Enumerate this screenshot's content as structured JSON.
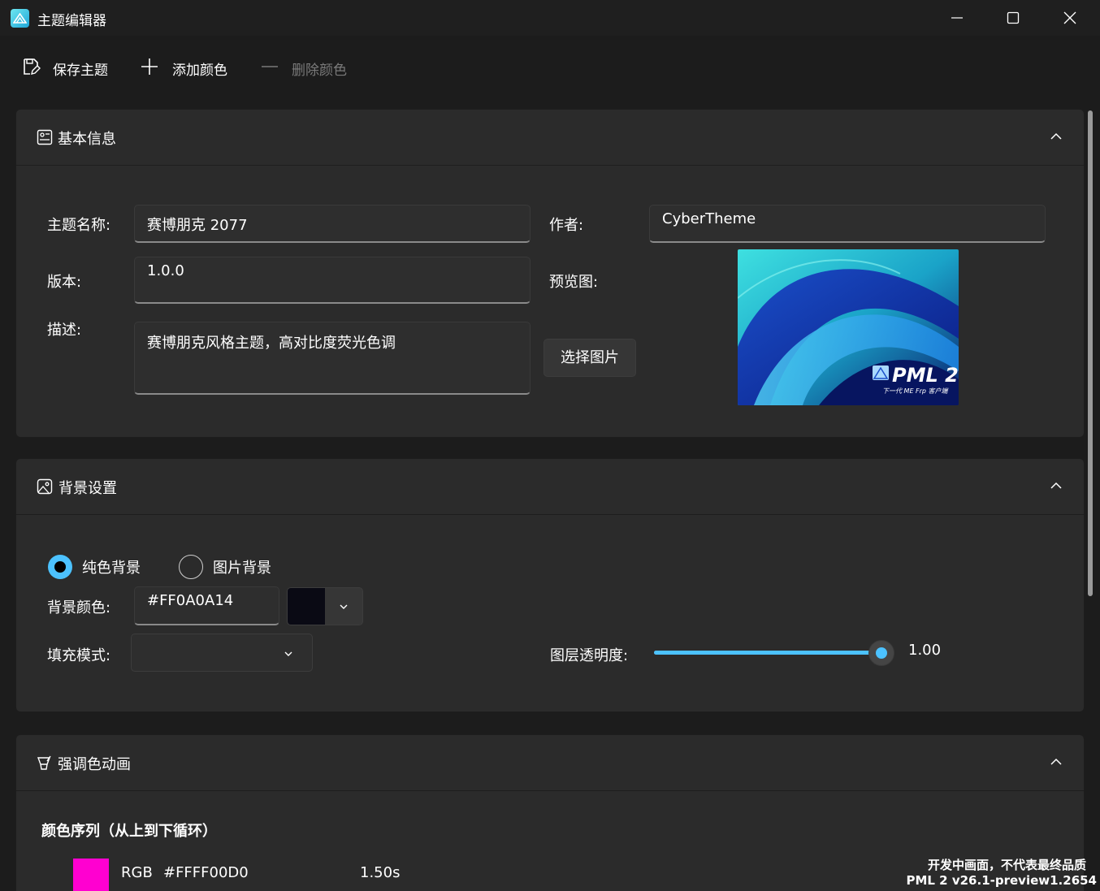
{
  "window": {
    "title": "主题编辑器"
  },
  "toolbar": {
    "save_label": "保存主题",
    "add_color_label": "添加颜色",
    "delete_color_label": "删除颜色"
  },
  "basic_info": {
    "title": "基本信息",
    "theme_name_label": "主题名称:",
    "theme_name_value": "赛博朋克 2077",
    "author_label": "作者:",
    "author_value": "CyberTheme",
    "version_label": "版本:",
    "version_value": "1.0.0",
    "preview_label": "预览图:",
    "description_label": "描述:",
    "description_value": "赛博朋克风格主题，高对比度荧光色调",
    "choose_image_label": "选择图片",
    "preview_logo_text": "PML 2",
    "preview_sub_text": "下一代 ME Frp 客户端"
  },
  "background": {
    "title": "背景设置",
    "solid_label": "纯色背景",
    "image_label": "图片背景",
    "selected_mode": "solid",
    "color_label": "背景颜色:",
    "color_value": "#FF0A0A14",
    "swatch_color": "#0a0a14",
    "fill_mode_label": "填充模式:",
    "fill_mode_value": "",
    "opacity_label": "图层透明度:",
    "opacity_value": "1.00",
    "opacity_fraction": 1.0
  },
  "accent_animation": {
    "title": "强调色动画",
    "sequence_heading": "颜色序列（从上到下循环）",
    "items": [
      {
        "swatch_color": "#ff00d0",
        "mode": "RGB",
        "hex": "#FFFF00D0",
        "duration": "1.50s"
      }
    ]
  },
  "watermark": {
    "line1": "开发中画面，不代表最终品质",
    "line2": "PML 2 v26.1-preview1.2654"
  },
  "colors": {
    "accent": "#4cc2ff",
    "card": "#2b2b2b",
    "window": "#1c1c1c"
  }
}
